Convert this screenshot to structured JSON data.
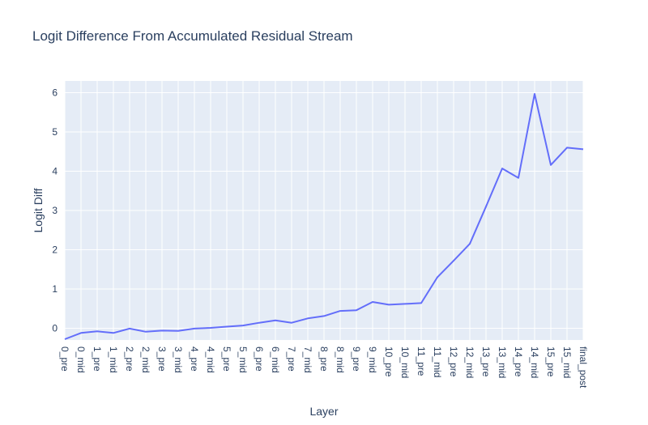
{
  "chart_data": {
    "type": "line",
    "title": "Logit Difference From Accumulated Residual Stream",
    "xlabel": "Layer",
    "ylabel": "Logit Diff",
    "ylim": [
      -0.3,
      6.3
    ],
    "yticks": [
      0,
      1,
      2,
      3,
      4,
      5,
      6
    ],
    "grid": true,
    "colors": {
      "plot_bg": "#e5ecf6",
      "grid": "#ffffff",
      "line": "#636efa",
      "text": "#2a3f5f"
    },
    "categories": [
      "0_pre",
      "0_mid",
      "1_pre",
      "1_mid",
      "2_pre",
      "2_mid",
      "3_pre",
      "3_mid",
      "4_pre",
      "4_mid",
      "5_pre",
      "5_mid",
      "6_pre",
      "6_mid",
      "7_pre",
      "7_mid",
      "8_pre",
      "8_mid",
      "9_pre",
      "9_mid",
      "10_pre",
      "10_mid",
      "11_pre",
      "11_mid",
      "12_pre",
      "12_mid",
      "13_pre",
      "13_mid",
      "14_pre",
      "14_mid",
      "15_pre",
      "15_mid",
      "final_post"
    ],
    "tick_labels": [
      "0_pre",
      "0_mid",
      "1_pre",
      "1_mid",
      "2_pre",
      "2_mid",
      "3_pre",
      "3_mid",
      "4_pre",
      "4_mid",
      "5_pre",
      "5_mid",
      "6_pre",
      "6_mid",
      "7_pre",
      "7_mid",
      "8_pre",
      "8_mid",
      "9_pre",
      "9_mid",
      "10_pre",
      "10_mid",
      "11_pre",
      "11_mid",
      "12_pre",
      "12_mid",
      "13_pre",
      "13_mid",
      "14_pre",
      "14_mid",
      "15_pre",
      "15_mid",
      "final_post"
    ],
    "series": [
      {
        "values": [
          -0.28,
          -0.12,
          -0.08,
          -0.12,
          -0.01,
          -0.09,
          -0.06,
          -0.07,
          -0.01,
          0.01,
          0.04,
          0.07,
          0.14,
          0.2,
          0.14,
          0.25,
          0.31,
          0.44,
          0.46,
          0.67,
          0.6,
          0.62,
          0.64,
          1.3,
          1.72,
          2.15,
          3.1,
          4.07,
          3.83,
          5.97,
          4.16,
          4.6,
          4.56
        ]
      }
    ]
  }
}
